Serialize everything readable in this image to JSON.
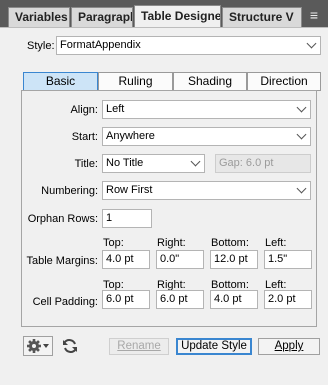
{
  "tabs": [
    {
      "label": "Variables"
    },
    {
      "label": "Paragraph I"
    },
    {
      "label": "Table Designer"
    },
    {
      "label": "Structure V"
    }
  ],
  "style": {
    "label": "Style:",
    "value": "FormatAppendix"
  },
  "subtabs": [
    {
      "label": "Basic"
    },
    {
      "label": "Ruling"
    },
    {
      "label": "Shading"
    },
    {
      "label": "Direction"
    }
  ],
  "align": {
    "label": "Align:",
    "value": "Left"
  },
  "start": {
    "label": "Start:",
    "value": "Anywhere"
  },
  "title": {
    "label": "Title:",
    "value": "No Title"
  },
  "gap": {
    "label": "Gap:",
    "value": "6.0 pt"
  },
  "numbering": {
    "label": "Numbering:",
    "value": "Row First"
  },
  "orphan": {
    "label": "Orphan Rows:",
    "value": "1"
  },
  "margins": {
    "label": "Table Margins:",
    "headers": [
      "Top:",
      "Right:",
      "Bottom:",
      "Left:"
    ],
    "values": [
      "4.0 pt",
      "0.0\"",
      "12.0 pt",
      "1.5\""
    ]
  },
  "padding": {
    "label": "Cell Padding:",
    "headers": [
      "Top:",
      "Right:",
      "Bottom:",
      "Left:"
    ],
    "values": [
      "6.0 pt",
      "6.0 pt",
      "4.0 pt",
      "2.0 pt"
    ]
  },
  "buttons": {
    "rename": "Rename",
    "update": "Update Style",
    "apply": "Apply"
  },
  "icons": {
    "menu": "hamburger-menu-icon",
    "gear": "gear-icon",
    "refresh": "refresh-icon"
  },
  "colors": {
    "active_seg": "#cde4f7",
    "focus": "#3a86d0"
  }
}
